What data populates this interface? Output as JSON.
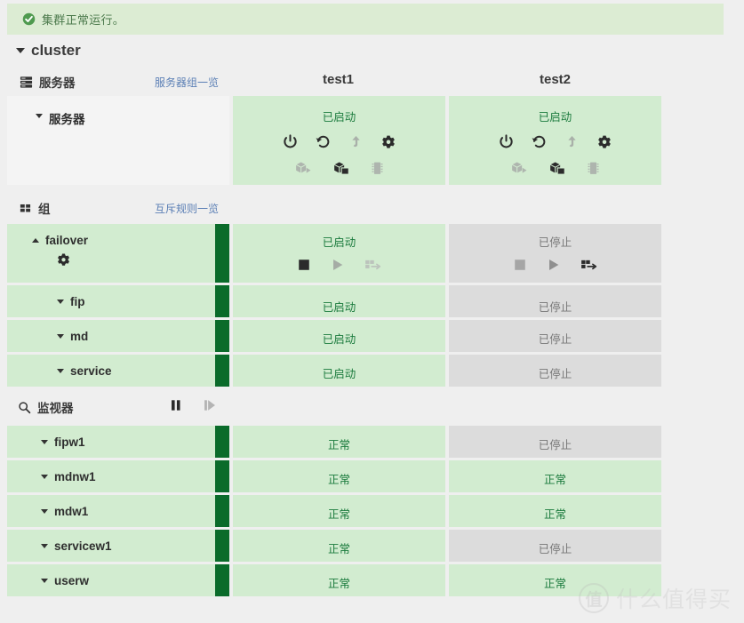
{
  "alert": {
    "icon": "check-circle-icon",
    "message": "集群正常运行。"
  },
  "cluster": {
    "name": "cluster",
    "expanded": true
  },
  "columns": [
    {
      "label": "test1"
    },
    {
      "label": "test2"
    }
  ],
  "colors": {
    "green_bg": "#d2ecd0",
    "grey_bg": "#dcdcdc",
    "bar_green": "#0a6b2a",
    "status_on_text": "#1a7a3c",
    "status_off_text": "#777777",
    "alert_bg": "#dcecd3",
    "link": "#5b7fb5",
    "page_bg": "#efefef"
  },
  "servers_section": {
    "icon": "server-rack-icon",
    "title": "服务器",
    "link": "服务器组一览",
    "row": {
      "name": "服务器",
      "expanded": true,
      "cells": [
        {
          "status": "已启动",
          "state": "on",
          "icons_top": [
            {
              "name": "power-icon",
              "enabled": true
            },
            {
              "name": "restart-icon",
              "enabled": true
            },
            {
              "name": "arrow-up-icon",
              "enabled": false
            },
            {
              "name": "gear-icon",
              "enabled": true
            }
          ],
          "icons_bottom": [
            {
              "name": "cube-play-icon",
              "enabled": false
            },
            {
              "name": "cube-stop-icon",
              "enabled": true
            },
            {
              "name": "memory-chip-icon",
              "enabled": false
            }
          ]
        },
        {
          "status": "已启动",
          "state": "on",
          "icons_top": [
            {
              "name": "power-icon",
              "enabled": true
            },
            {
              "name": "restart-icon",
              "enabled": true
            },
            {
              "name": "arrow-up-icon",
              "enabled": false
            },
            {
              "name": "gear-icon",
              "enabled": true
            }
          ],
          "icons_bottom": [
            {
              "name": "cube-play-icon",
              "enabled": false
            },
            {
              "name": "cube-stop-icon",
              "enabled": true
            },
            {
              "name": "memory-chip-icon",
              "enabled": false
            }
          ]
        }
      ]
    }
  },
  "groups_section": {
    "icon": "grid-squares-icon",
    "title": "组",
    "link": "互斥规则一览",
    "rows": [
      {
        "name": "failover",
        "level": 0,
        "expanded": true,
        "toggle": "tri-up",
        "has_gear": true,
        "gear_icon": "gear-icon",
        "cells": [
          {
            "status": "已启动",
            "state": "on",
            "icons": [
              {
                "name": "stop-icon",
                "enabled": true
              },
              {
                "name": "play-icon",
                "enabled": false
              },
              {
                "name": "migrate-icon",
                "enabled": false
              }
            ]
          },
          {
            "status": "已停止",
            "state": "off",
            "icons": [
              {
                "name": "stop-icon",
                "enabled": false
              },
              {
                "name": "play-icon",
                "enabled": false
              },
              {
                "name": "migrate-icon",
                "enabled": true
              }
            ]
          }
        ]
      },
      {
        "name": "fip",
        "level": 1,
        "expanded": true,
        "toggle": "tri-down",
        "has_gear": false,
        "cells": [
          {
            "status": "已启动",
            "state": "on",
            "icons": []
          },
          {
            "status": "已停止",
            "state": "off",
            "icons": []
          }
        ]
      },
      {
        "name": "md",
        "level": 1,
        "expanded": true,
        "toggle": "tri-down",
        "has_gear": false,
        "cells": [
          {
            "status": "已启动",
            "state": "on",
            "icons": []
          },
          {
            "status": "已停止",
            "state": "off",
            "icons": []
          }
        ]
      },
      {
        "name": "service",
        "level": 1,
        "expanded": true,
        "toggle": "tri-down",
        "has_gear": false,
        "cells": [
          {
            "status": "已启动",
            "state": "on",
            "icons": []
          },
          {
            "status": "已停止",
            "state": "off",
            "icons": []
          }
        ]
      }
    ]
  },
  "monitors_section": {
    "icon": "magnifier-icon",
    "title": "监视器",
    "controls": [
      {
        "name": "pause-icon",
        "enabled": true
      },
      {
        "name": "resume-icon",
        "enabled": false
      }
    ],
    "rows": [
      {
        "name": "fipw1",
        "toggle": "tri-down",
        "cells": [
          {
            "status": "正常",
            "state": "on"
          },
          {
            "status": "已停止",
            "state": "off"
          }
        ]
      },
      {
        "name": "mdnw1",
        "toggle": "tri-down",
        "cells": [
          {
            "status": "正常",
            "state": "on"
          },
          {
            "status": "正常",
            "state": "on"
          }
        ]
      },
      {
        "name": "mdw1",
        "toggle": "tri-down",
        "cells": [
          {
            "status": "正常",
            "state": "on"
          },
          {
            "status": "正常",
            "state": "on"
          }
        ]
      },
      {
        "name": "servicew1",
        "toggle": "tri-down",
        "cells": [
          {
            "status": "正常",
            "state": "on"
          },
          {
            "status": "已停止",
            "state": "off"
          }
        ]
      },
      {
        "name": "userw",
        "toggle": "tri-down",
        "cells": [
          {
            "status": "正常",
            "state": "on"
          },
          {
            "status": "正常",
            "state": "on"
          }
        ]
      }
    ]
  },
  "watermark": {
    "logo_char": "值",
    "text": "什么值得买"
  }
}
